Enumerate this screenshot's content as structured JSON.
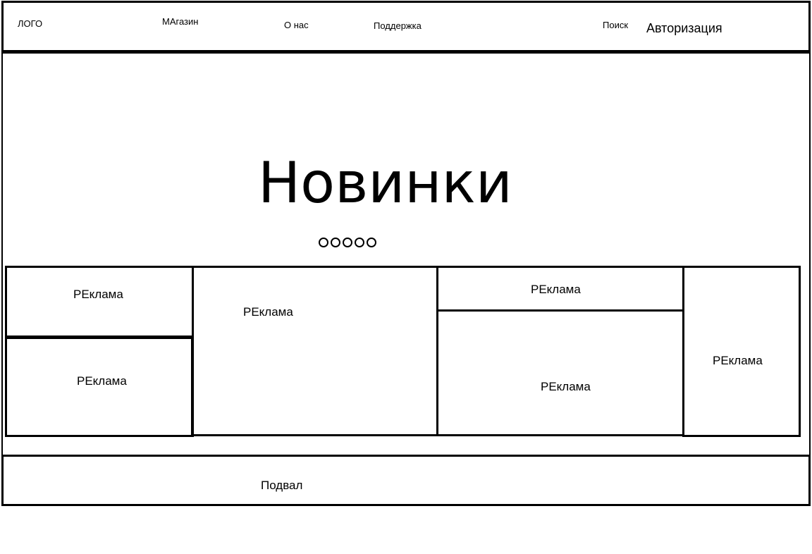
{
  "header": {
    "logo": "ЛОГО",
    "nav": [
      "МАгазин",
      "О нас",
      "Поддержка"
    ],
    "search": "Поиск",
    "login": "Авторизация"
  },
  "hero": {
    "title": "Новинки",
    "slide_count": 5
  },
  "ads": [
    "РЕклама",
    "РЕклама",
    "РЕклама",
    "РЕклама",
    "РЕклама",
    "РЕклама"
  ],
  "footer": {
    "label": "Подвал"
  }
}
